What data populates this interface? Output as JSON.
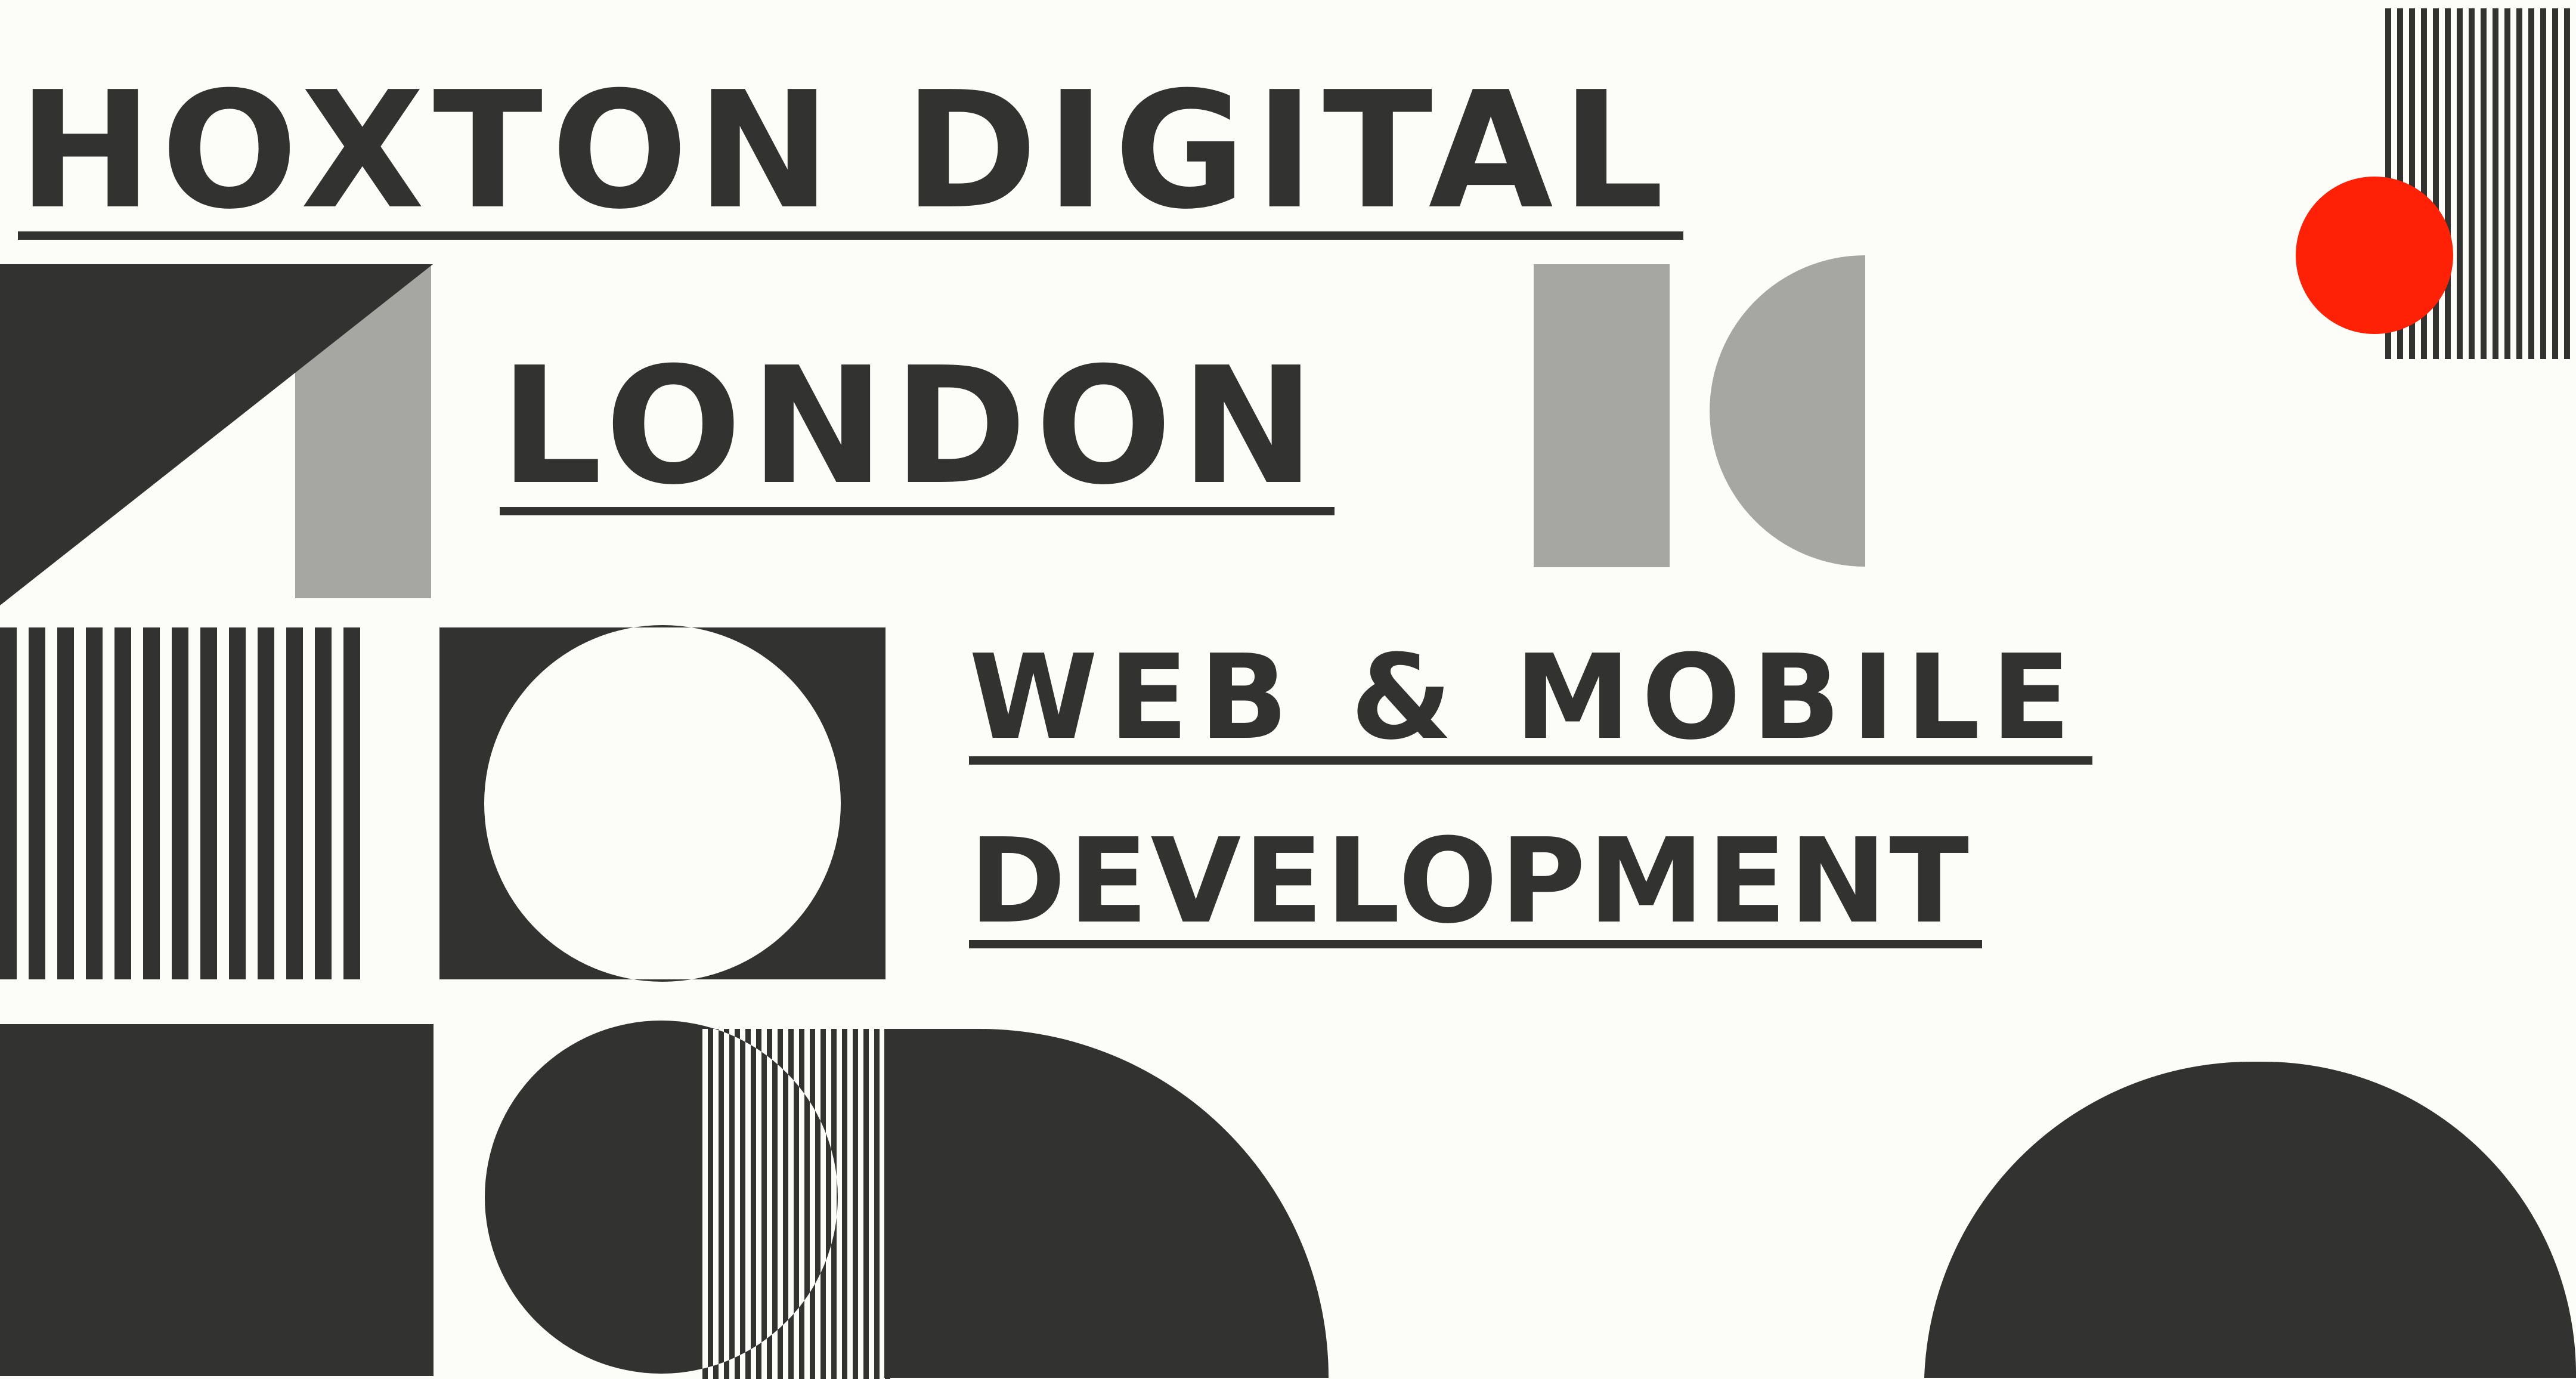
{
  "headline": {
    "line1": "HOXTON DIGITAL",
    "line2": "LONDON",
    "line3": "WEB & MOBILE",
    "line4": "DEVELOPMENT"
  },
  "colors": {
    "background": "#fcfcf8",
    "ink": "#323230",
    "grey": "#a6a6a3",
    "accent": "#fe2105"
  }
}
